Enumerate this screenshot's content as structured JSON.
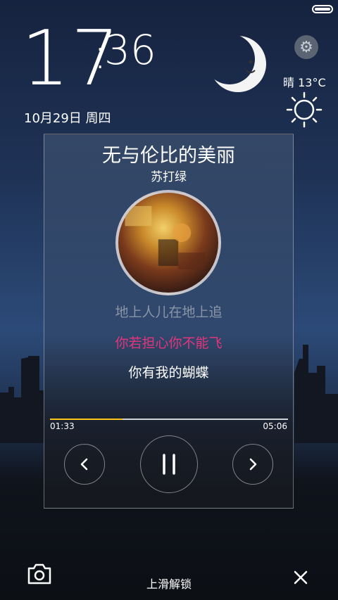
{
  "clock": {
    "hours": "17",
    "minutes": "36"
  },
  "date": "10月29日 周四",
  "weather": {
    "text": "晴  13°C",
    "icon": "sun-icon"
  },
  "music": {
    "title": "无与伦比的美丽",
    "artist": "苏打绿",
    "lyrics": [
      "地上人儿在地上追",
      "你若担心你不能飞",
      "你有我的蝴蝶"
    ],
    "current_time": "01:33",
    "total_time": "05:06",
    "progress": 0.305,
    "state": "playing"
  },
  "bottom": {
    "unlock_label": "上滑解锁"
  },
  "colors": {
    "active_lyric": "#e2357a",
    "progress_fill": "#ffc61a",
    "past_lyric": "#8a95a8"
  }
}
